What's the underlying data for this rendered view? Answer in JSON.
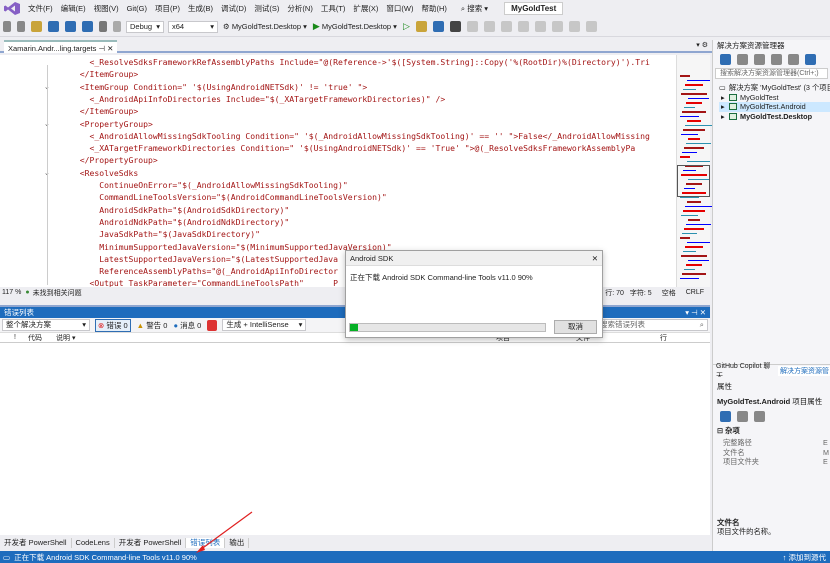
{
  "menubar": {
    "items": [
      "文件(F)",
      "编辑(E)",
      "视图(V)",
      "Git(G)",
      "项目(P)",
      "生成(B)",
      "调试(D)",
      "测试(S)",
      "分析(N)",
      "工具(T)",
      "扩展(X)",
      "窗口(W)",
      "帮助(H)"
    ],
    "search_label": "搜索",
    "solution_name": "MyGoldTest"
  },
  "toolbar": {
    "config": "Debug",
    "platform": "x64",
    "startup_project": "MyGoldTest.Desktop",
    "run_target": "MyGoldTest.Desktop"
  },
  "document": {
    "tab_label": "Xamarin.Andr...ling.targets",
    "zoom": "117 %",
    "issues": "未找到相关问题",
    "line": "行: 70",
    "col": "字符: 5",
    "spaces": "空格",
    "eol": "CRLF"
  },
  "code_lines": [
    "    <_ResolveSdksFrameworkRefAssemblyPaths Include=\"@(Reference->'$([System.String]::Copy('%(RootDir)%(Directory)').Tri",
    "  </ItemGroup>",
    "  <ItemGroup Condition=\" '$(UsingAndroidNETSdk)' != 'true' \">",
    "    <_AndroidApiInfoDirectories Include=\"$(_XATargetFrameworkDirectories)\" />",
    "  </ItemGroup>",
    "  <PropertyGroup>",
    "    <_AndroidAllowMissingSdkTooling Condition=\" '$(_AndroidAllowMissingSdkTooling)' == '' \">False</_AndroidAllowMissing",
    "    <_XATargetFrameworkDirectories Condition=\" '$(UsingAndroidNETSdk)' == 'True' \">@(_ResolveSdksFrameworkAssemblyPa",
    "  </PropertyGroup>",
    "  <ResolveSdks",
    "      ContinueOnError=\"$(_AndroidAllowMissingSdkTooling)\"",
    "      CommandLineToolsVersion=\"$(AndroidCommandLineToolsVersion)\"",
    "      AndroidSdkPath=\"$(AndroidSdkDirectory)\"",
    "      AndroidNdkPath=\"$(AndroidNdkDirectory)\"",
    "      JavaSdkPath=\"$(JavaSdkDirectory)\"",
    "      MinimumSupportedJavaVersion=\"$(MinimumSupportedJavaVersion)\"",
    "      LatestSupportedJavaVersion=\"$(LatestSupportedJava",
    "      ReferenceAssemblyPaths=\"@(_AndroidApiInfoDirector",
    "    <Output TaskParameter=\"CommandLineToolsPath\"      P"
  ],
  "error_list": {
    "title": "错误列表",
    "scope": "整个解决方案",
    "errors": "错误 0",
    "warnings": "警告 0",
    "messages": "消息 0",
    "build_filter": "生成 + IntelliSense",
    "search_placeholder": "搜索错误列表",
    "col_code": "代码",
    "col_desc": "说明",
    "col_project": "项目",
    "col_file": "文件",
    "col_line": "行"
  },
  "bottom_tabs": [
    "开发者 PowerShell",
    "CodeLens",
    "开发者 PowerShell",
    "错误列表",
    "输出"
  ],
  "status_text": "正在下载 Android SDK Command-line Tools v11.0 90%",
  "status_right": "添加到源代",
  "solution_explorer": {
    "title": "解决方案资源管理器",
    "search_placeholder": "搜索解决方案资源管理器(Ctrl+;)",
    "solution_node": "解决方案 'MyGoldTest' (3 个项目",
    "projects": [
      "MyGoldTest",
      "MyGoldTest.Android",
      "MyGoldTest.Desktop"
    ],
    "tab_copilot": "GitHub Copilot 聊天",
    "tab_solution": "解决方案资源管"
  },
  "properties": {
    "title": "属性",
    "object": "MyGoldTest.Android",
    "object_kind": "项目属性",
    "category": "杂项",
    "rows": [
      {
        "name": "完整路径",
        "value": "E"
      },
      {
        "name": "文件名",
        "value": "M"
      },
      {
        "name": "项目文件夹",
        "value": "E"
      }
    ],
    "desc_title": "文件名",
    "desc_text": "项目文件的名称。"
  },
  "dialog": {
    "title": "Android SDK",
    "message": "正在下载 Android SDK Command-line Tools v11.0 90%",
    "progress": 0.04,
    "cancel_label": "取消"
  },
  "colors": {
    "accent": "#1e6cbd",
    "progress_fill": "#06b025",
    "annotation_arrow": "#e02020"
  }
}
